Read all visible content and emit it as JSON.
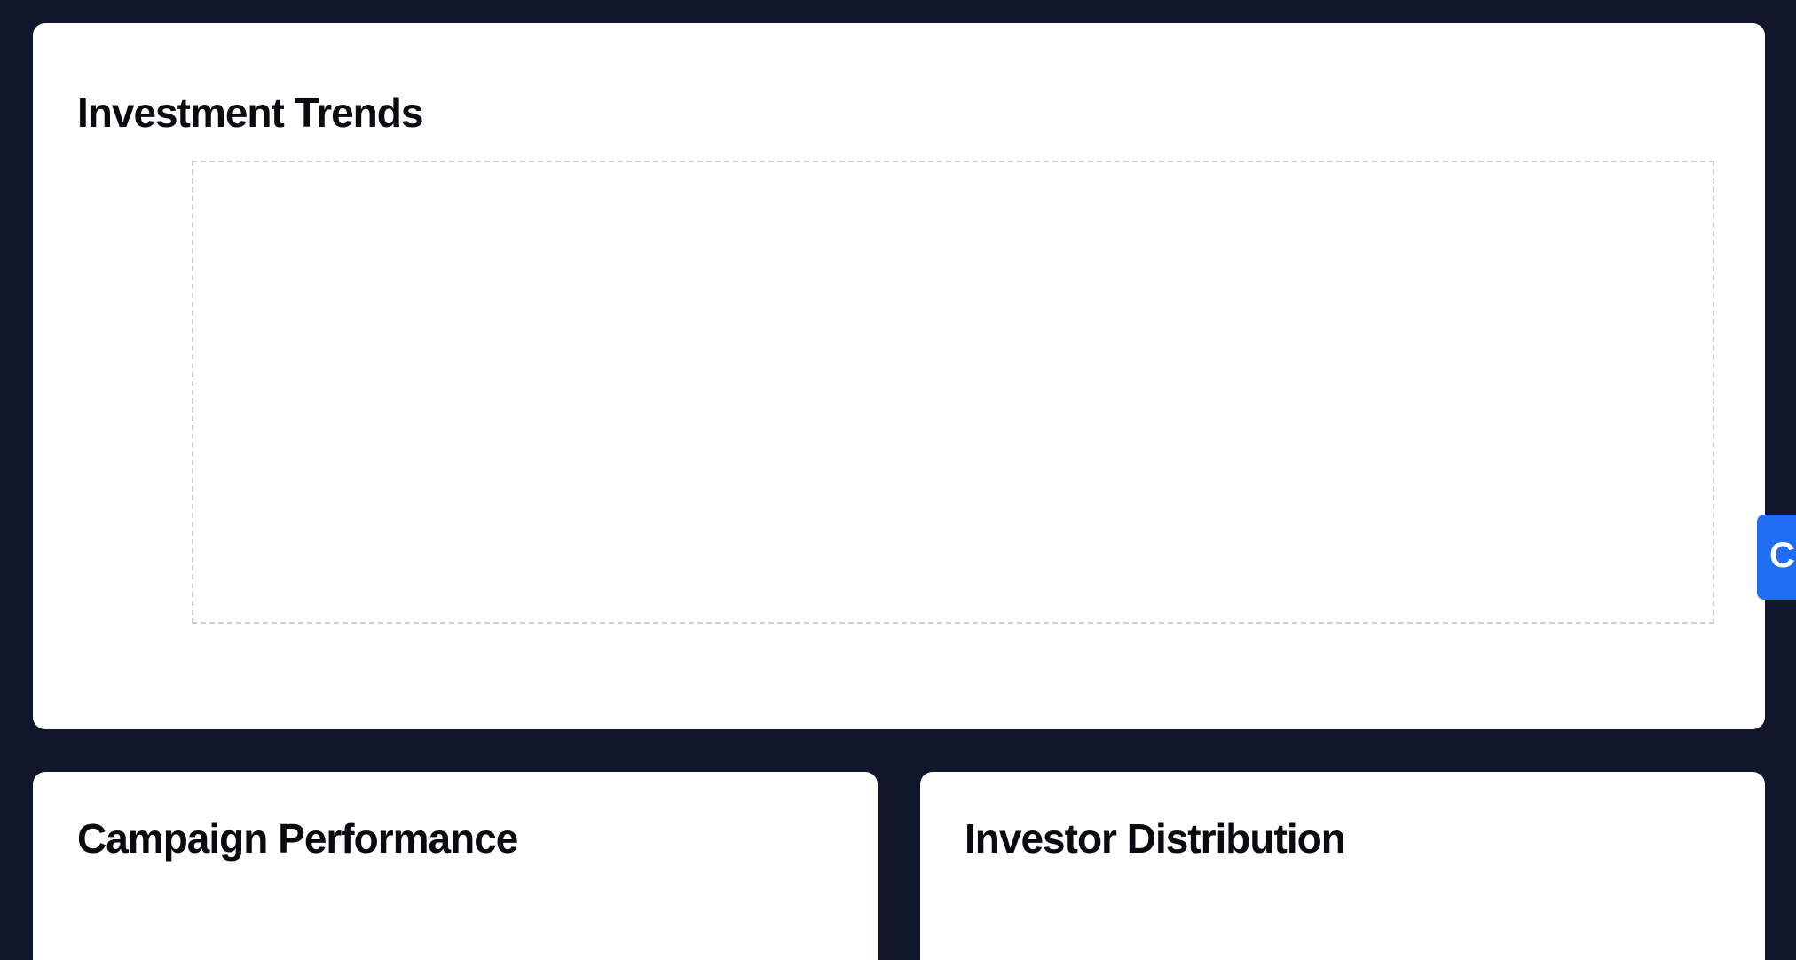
{
  "investment_trends": {
    "title": "Investment Trends"
  },
  "campaign_performance": {
    "title": "Campaign Performance"
  },
  "investor_distribution": {
    "title": "Investor Distribution"
  },
  "side_tab": {
    "label": "C",
    "color": "#1f6cf5"
  },
  "theme": {
    "background": "#11172a",
    "card_background": "#ffffff"
  }
}
